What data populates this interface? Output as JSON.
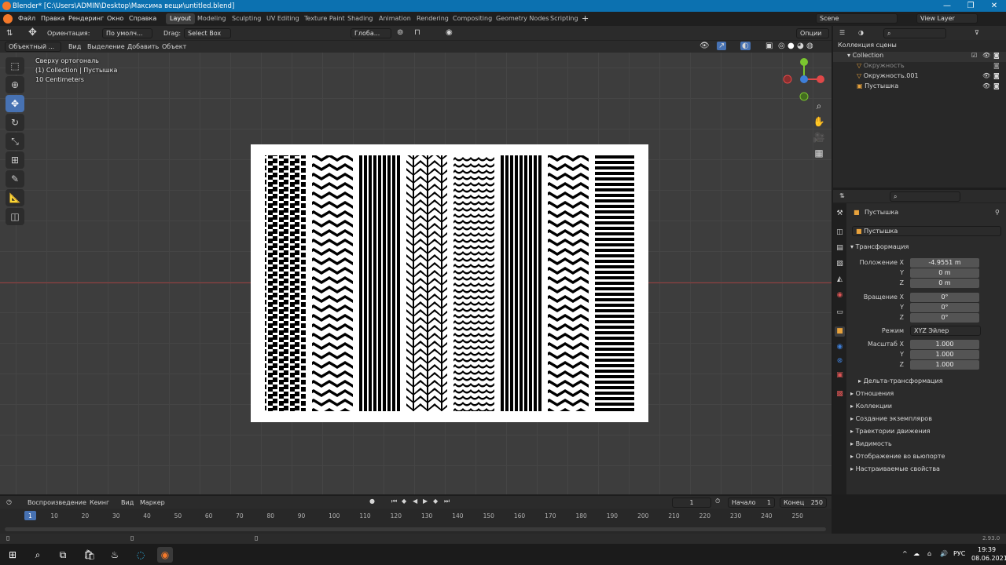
{
  "titlebar": {
    "title": "Blender* [C:\\Users\\ADMIN\\Desktop\\Максима вещи\\untitled.blend]",
    "minimize": "—",
    "maximize": "❐",
    "close": "✕"
  },
  "menu": {
    "items": [
      "Файл",
      "Правка",
      "Рендеринг",
      "Окно",
      "Справка"
    ],
    "workspaces": [
      "Layout",
      "Modeling",
      "Sculpting",
      "UV Editing",
      "Texture Paint",
      "Shading",
      "Animation",
      "Rendering",
      "Compositing",
      "Geometry Nodes",
      "Scripting"
    ],
    "active_workspace": "Layout",
    "add_tab": "+",
    "scene": "Scene",
    "view_layer": "View Layer"
  },
  "tool_header": {
    "orientation_label": "Ориентация:",
    "orientation_value": "По умолч...",
    "drag_label": "Drag:",
    "drag_value": "Select Box",
    "transform_global": "Глоба...",
    "options": "Опции"
  },
  "viewport_header": {
    "mode": "Объектный ...",
    "items": [
      "Вид",
      "Выделение",
      "Добавить",
      "Объект"
    ]
  },
  "viewport": {
    "overlay_lines": [
      "Сверху ортогональ",
      "(1) Collection | Пустышка",
      "10 Centimeters"
    ],
    "gizmo": {
      "x": "X",
      "y": "Y",
      "z": "Z"
    }
  },
  "outliner": {
    "root": "Коллекция сцены",
    "collection": "Collection",
    "objects": [
      "Окружность",
      "Окружность.001",
      "Пустышка"
    ]
  },
  "properties": {
    "object_name": "Пустышка",
    "object_field": "Пустышка",
    "transform_section": "Трансформация",
    "location": {
      "label": "Положение X",
      "x": "-4.9551 m",
      "y": "0 m",
      "z": "0 m"
    },
    "rotation": {
      "label": "Вращение X",
      "x": "0°",
      "y": "0°",
      "z": "0°"
    },
    "mode": {
      "label": "Режим",
      "value": "XYZ Эйлер"
    },
    "scale": {
      "label": "Масштаб X",
      "x": "1.000",
      "y": "1.000",
      "z": "1.000"
    },
    "axis_y": "Y",
    "axis_z": "Z",
    "delta": "Дельта-трансформация",
    "sections": [
      "Отношения",
      "Коллекции",
      "Создание экземпляров",
      "Траектории движения",
      "Видимость",
      "Отображение во вьюпорте",
      "Настраиваемые свойства"
    ]
  },
  "timeline": {
    "items": [
      "Воспроизведение",
      "Кеинг",
      "Вид",
      "Маркер"
    ],
    "current_frame": "1",
    "start_label": "Начало",
    "start": "1",
    "end_label": "Конец",
    "end": "250",
    "ticks": [
      "1",
      "10",
      "20",
      "30",
      "40",
      "50",
      "60",
      "70",
      "80",
      "90",
      "100",
      "110",
      "120",
      "130",
      "140",
      "150",
      "160",
      "170",
      "180",
      "190",
      "200",
      "210",
      "220",
      "230",
      "240",
      "250"
    ]
  },
  "status": {
    "version": "2.93.0"
  },
  "taskbar": {
    "time": "19:39",
    "date": "08.06.2021",
    "lang": "РУС"
  }
}
